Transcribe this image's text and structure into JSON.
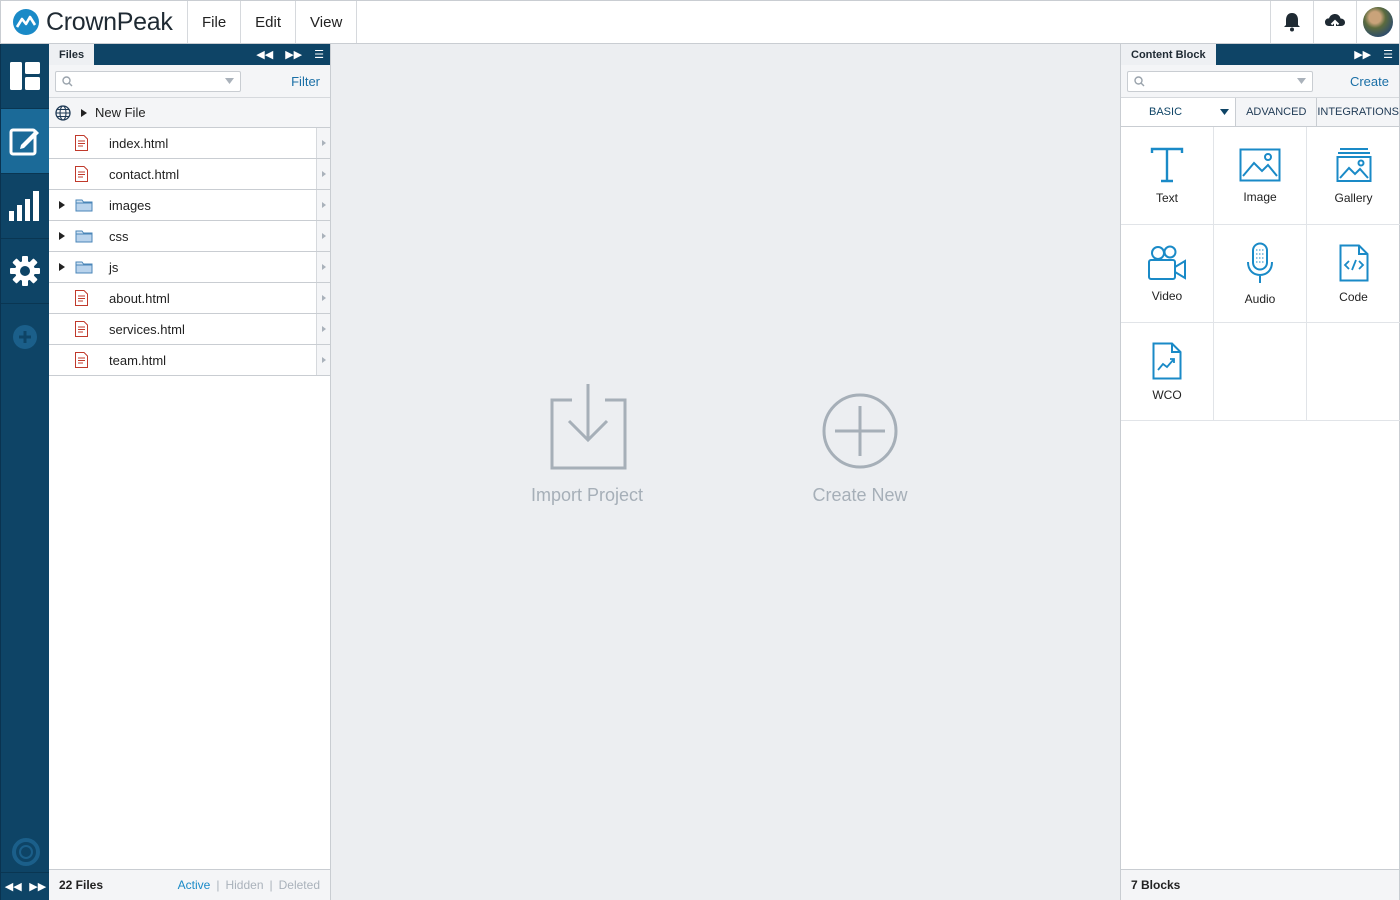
{
  "app": {
    "name": "CrownPeak"
  },
  "menu": [
    "File",
    "Edit",
    "View"
  ],
  "toolbar_icons": [
    "bell-icon",
    "cloud-upload-icon",
    "user-avatar"
  ],
  "rail": [
    {
      "icon": "dashboard-icon",
      "active": false
    },
    {
      "icon": "edit-icon",
      "active": true
    },
    {
      "icon": "analytics-icon",
      "active": false
    },
    {
      "icon": "settings-icon",
      "active": false
    },
    {
      "icon": "add-icon",
      "active": false
    }
  ],
  "files_panel": {
    "tab_label": "Files",
    "search_placeholder": "",
    "filter_label": "Filter",
    "new_file_label": "New File",
    "items": [
      {
        "name": "index.html",
        "type": "file"
      },
      {
        "name": "contact.html",
        "type": "file"
      },
      {
        "name": "images",
        "type": "folder"
      },
      {
        "name": "css",
        "type": "folder"
      },
      {
        "name": "js",
        "type": "folder"
      },
      {
        "name": "about.html",
        "type": "file"
      },
      {
        "name": "services.html",
        "type": "file"
      },
      {
        "name": "team.html",
        "type": "file"
      }
    ],
    "count_label": "22 Files",
    "filters": [
      "Active",
      "Hidden",
      "Deleted"
    ],
    "active_filter": "Active"
  },
  "center": {
    "import_label": "Import Project",
    "create_label": "Create New"
  },
  "blocks_panel": {
    "tab_label": "Content Block",
    "search_placeholder": "",
    "create_label": "Create",
    "tabs": [
      "BASIC",
      "ADVANCED",
      "INTEGRATIONS"
    ],
    "active_tab": "BASIC",
    "items": [
      {
        "label": "Text",
        "icon": "text-icon"
      },
      {
        "label": "Image",
        "icon": "image-icon"
      },
      {
        "label": "Gallery",
        "icon": "gallery-icon"
      },
      {
        "label": "Video",
        "icon": "video-icon"
      },
      {
        "label": "Audio",
        "icon": "audio-icon"
      },
      {
        "label": "Code",
        "icon": "code-icon"
      },
      {
        "label": "WCO",
        "icon": "wco-icon"
      }
    ],
    "count_label": "7 Blocks"
  },
  "colors": {
    "accent": "#1a8ac7",
    "rail": "#0e4466",
    "rail_active": "#1b6a98",
    "muted": "#a6afb8"
  }
}
